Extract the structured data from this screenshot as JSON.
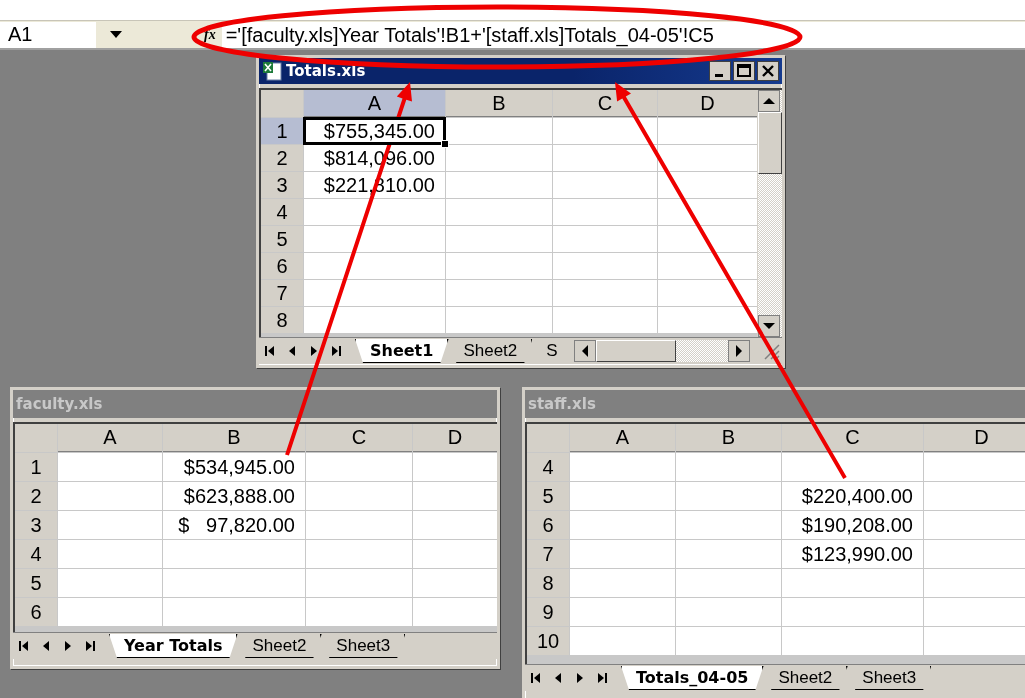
{
  "formula_bar": {
    "name_box": "A1",
    "function_label": "fx",
    "formula": "='[faculty.xls]Year Totals'!B1+'[staff.xls]Totals_04-05'!C5"
  },
  "windows": [
    {
      "title": "Totals.xls",
      "active": true,
      "columns": [
        {
          "label": "A",
          "selected": true
        },
        {
          "label": "B",
          "selected": false
        },
        {
          "label": "C",
          "selected": false
        },
        {
          "label": "D",
          "selected": false
        }
      ],
      "rows": [
        {
          "label": "1",
          "selected": true,
          "cells": [
            "$755,345.00",
            "",
            "",
            ""
          ]
        },
        {
          "label": "2",
          "selected": false,
          "cells": [
            "$814,096.00",
            "",
            "",
            ""
          ]
        },
        {
          "label": "3",
          "selected": false,
          "cells": [
            "$221,810.00",
            "",
            "",
            ""
          ]
        },
        {
          "label": "4",
          "selected": false,
          "cells": [
            "",
            "",
            "",
            ""
          ]
        },
        {
          "label": "5",
          "selected": false,
          "cells": [
            "",
            "",
            "",
            ""
          ]
        },
        {
          "label": "6",
          "selected": false,
          "cells": [
            "",
            "",
            "",
            ""
          ]
        },
        {
          "label": "7",
          "selected": false,
          "cells": [
            "",
            "",
            "",
            ""
          ]
        },
        {
          "label": "8",
          "selected": false,
          "cells": [
            "",
            "",
            "",
            ""
          ]
        }
      ],
      "sheet_tabs": [
        {
          "label": "Sheet1",
          "selected": true
        },
        {
          "label": "Sheet2",
          "selected": false
        },
        {
          "label": "S",
          "selected": false
        }
      ]
    },
    {
      "title": "faculty.xls",
      "active": false,
      "columns": [
        {
          "label": "A",
          "selected": false
        },
        {
          "label": "B",
          "selected": false
        },
        {
          "label": "C",
          "selected": false
        },
        {
          "label": "D",
          "selected": false
        }
      ],
      "rows": [
        {
          "label": "1",
          "selected": false,
          "cells": [
            "",
            "$534,945.00",
            "",
            ""
          ]
        },
        {
          "label": "2",
          "selected": false,
          "cells": [
            "",
            "$623,888.00",
            "",
            ""
          ]
        },
        {
          "label": "3",
          "selected": false,
          "cells": [
            "",
            "$   97,820.00",
            "",
            ""
          ]
        },
        {
          "label": "4",
          "selected": false,
          "cells": [
            "",
            "",
            "",
            ""
          ]
        },
        {
          "label": "5",
          "selected": false,
          "cells": [
            "",
            "",
            "",
            ""
          ]
        },
        {
          "label": "6",
          "selected": false,
          "cells": [
            "",
            "",
            "",
            ""
          ]
        }
      ],
      "sheet_tabs": [
        {
          "label": "Year Totals",
          "selected": true
        },
        {
          "label": "Sheet2",
          "selected": false
        },
        {
          "label": "Sheet3",
          "selected": false
        }
      ]
    },
    {
      "title": "staff.xls",
      "active": false,
      "columns": [
        {
          "label": "A",
          "selected": false
        },
        {
          "label": "B",
          "selected": false
        },
        {
          "label": "C",
          "selected": false
        },
        {
          "label": "D",
          "selected": false
        }
      ],
      "rows": [
        {
          "label": "4",
          "selected": false,
          "cells": [
            "",
            "",
            "",
            ""
          ]
        },
        {
          "label": "5",
          "selected": false,
          "cells": [
            "",
            "",
            "$220,400.00",
            ""
          ]
        },
        {
          "label": "6",
          "selected": false,
          "cells": [
            "",
            "",
            "$190,208.00",
            ""
          ]
        },
        {
          "label": "7",
          "selected": false,
          "cells": [
            "",
            "",
            "$123,990.00",
            ""
          ]
        },
        {
          "label": "8",
          "selected": false,
          "cells": [
            "",
            "",
            "",
            ""
          ]
        },
        {
          "label": "9",
          "selected": false,
          "cells": [
            "",
            "",
            "",
            ""
          ]
        },
        {
          "label": "10",
          "selected": false,
          "cells": [
            "",
            "",
            "",
            ""
          ]
        }
      ],
      "sheet_tabs": [
        {
          "label": "Totals_04-05",
          "selected": true
        },
        {
          "label": "Sheet2",
          "selected": false
        },
        {
          "label": "Sheet3",
          "selected": false
        }
      ]
    }
  ],
  "annotations": [
    {
      "kind": "ellipse"
    },
    {
      "kind": "arrow"
    },
    {
      "kind": "arrow"
    }
  ]
}
